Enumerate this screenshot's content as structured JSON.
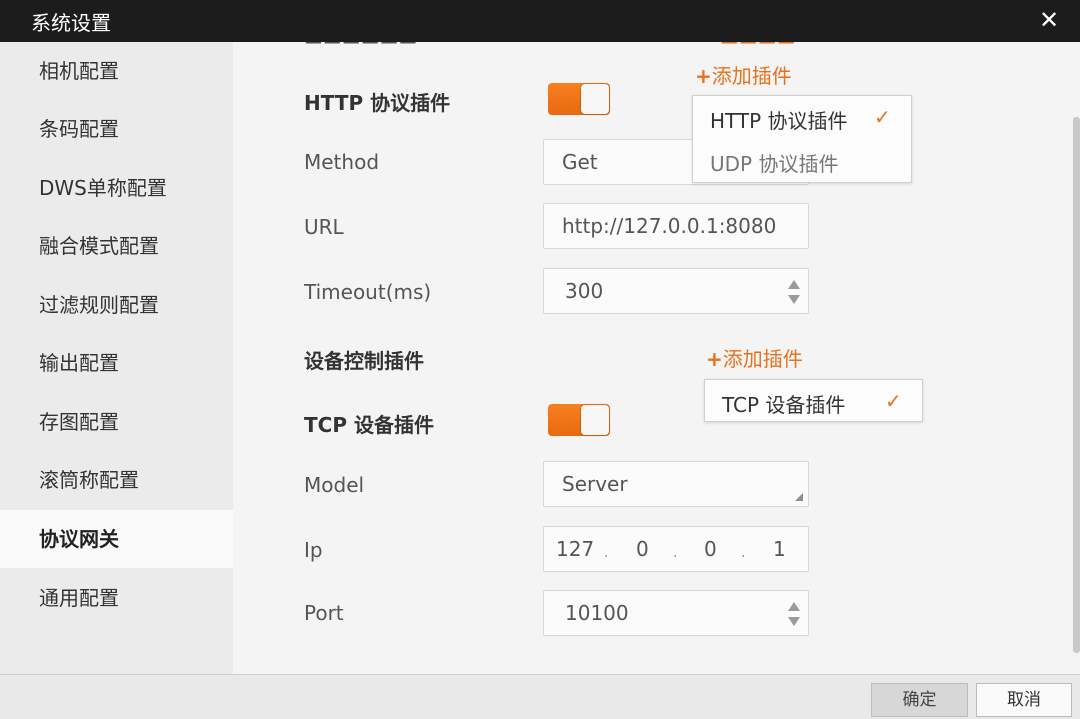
{
  "window": {
    "title": "系统设置",
    "close_icon": "close-icon"
  },
  "sidebar": {
    "items": [
      {
        "label": "相机配置",
        "active": false
      },
      {
        "label": "条码配置",
        "active": false
      },
      {
        "label": "DWS单称配置",
        "active": false
      },
      {
        "label": "融合模式配置",
        "active": false
      },
      {
        "label": "过滤规则配置",
        "active": false
      },
      {
        "label": "输出配置",
        "active": false
      },
      {
        "label": "存图配置",
        "active": false
      },
      {
        "label": "滚筒称配置",
        "active": false
      },
      {
        "label": "协议网关",
        "active": true
      },
      {
        "label": "通用配置",
        "active": false
      }
    ]
  },
  "colors": {
    "accent": "#e8711b",
    "titlebar": "#1c1c1c"
  },
  "http_section": {
    "add_plugin_label": "添加插件",
    "plugin_title": "HTTP 协议插件",
    "enabled": true,
    "dropdown": [
      {
        "label": "HTTP 协议插件",
        "checked": true
      },
      {
        "label": "UDP 协议插件",
        "checked": false
      }
    ],
    "method_label": "Method",
    "method_value": "Get",
    "url_label": "URL",
    "url_value": "http://127.0.0.1:8080",
    "timeout_label": "Timeout(ms)",
    "timeout_value": "300"
  },
  "device_section": {
    "title": "设备控制插件",
    "add_plugin_label": "添加插件",
    "dropdown": [
      {
        "label": "TCP 设备插件",
        "checked": true
      }
    ],
    "plugin_title": "TCP 设备插件",
    "enabled": true,
    "model_label": "Model",
    "model_value": "Server",
    "ip_label": "Ip",
    "ip": [
      "127",
      "0",
      "0",
      "1"
    ],
    "port_label": "Port",
    "port_value": "10100"
  },
  "footer": {
    "ok_label": "确定",
    "cancel_label": "取消"
  }
}
